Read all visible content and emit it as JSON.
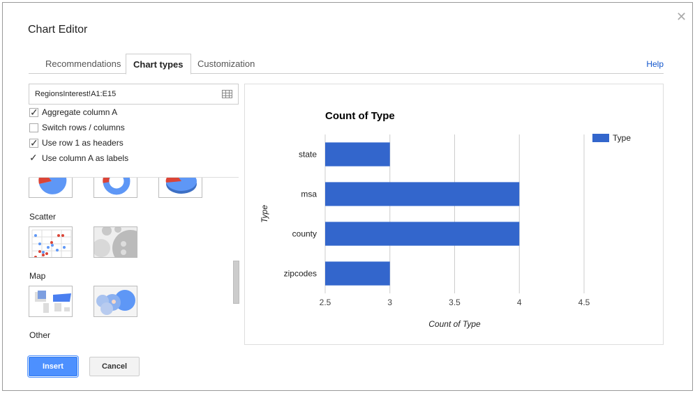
{
  "dialog": {
    "title": "Chart Editor",
    "close_icon": "close-icon"
  },
  "tabs": [
    {
      "label": "Recommendations"
    },
    {
      "label": "Chart types",
      "active": true
    },
    {
      "label": "Customization"
    }
  ],
  "help_label": "Help",
  "range": {
    "value": "RegionsInterest!A1:E15",
    "icon": "grid-icon"
  },
  "options": [
    {
      "label": "Aggregate column A",
      "checked": true
    },
    {
      "label": "Switch rows / columns",
      "checked": false
    },
    {
      "label": "Use row 1 as headers",
      "checked": true
    },
    {
      "label": "Use column A as labels",
      "checked": true
    }
  ],
  "gallery": {
    "sections": [
      {
        "label": "Scatter"
      },
      {
        "label": "Map"
      },
      {
        "label": "Other"
      }
    ]
  },
  "buttons": {
    "insert": "Insert",
    "cancel": "Cancel"
  },
  "colors": {
    "bar": "#3366cc",
    "accent": "#4d90fe",
    "pie_red": "#db4437",
    "pie_blue": "#5e97f6"
  },
  "chart_data": {
    "type": "bar",
    "orientation": "horizontal",
    "title": "Count of Type",
    "categories": [
      "state",
      "msa",
      "county",
      "zipcodes"
    ],
    "series": [
      {
        "name": "Type",
        "values": [
          3,
          4,
          4,
          3
        ]
      }
    ],
    "xlabel": "Count of Type",
    "ylabel": "Type",
    "xlim": [
      2.5,
      4.5
    ],
    "xticks": [
      "2.5",
      "3",
      "3.5",
      "4",
      "4.5"
    ],
    "grid": true,
    "legend": "right"
  }
}
